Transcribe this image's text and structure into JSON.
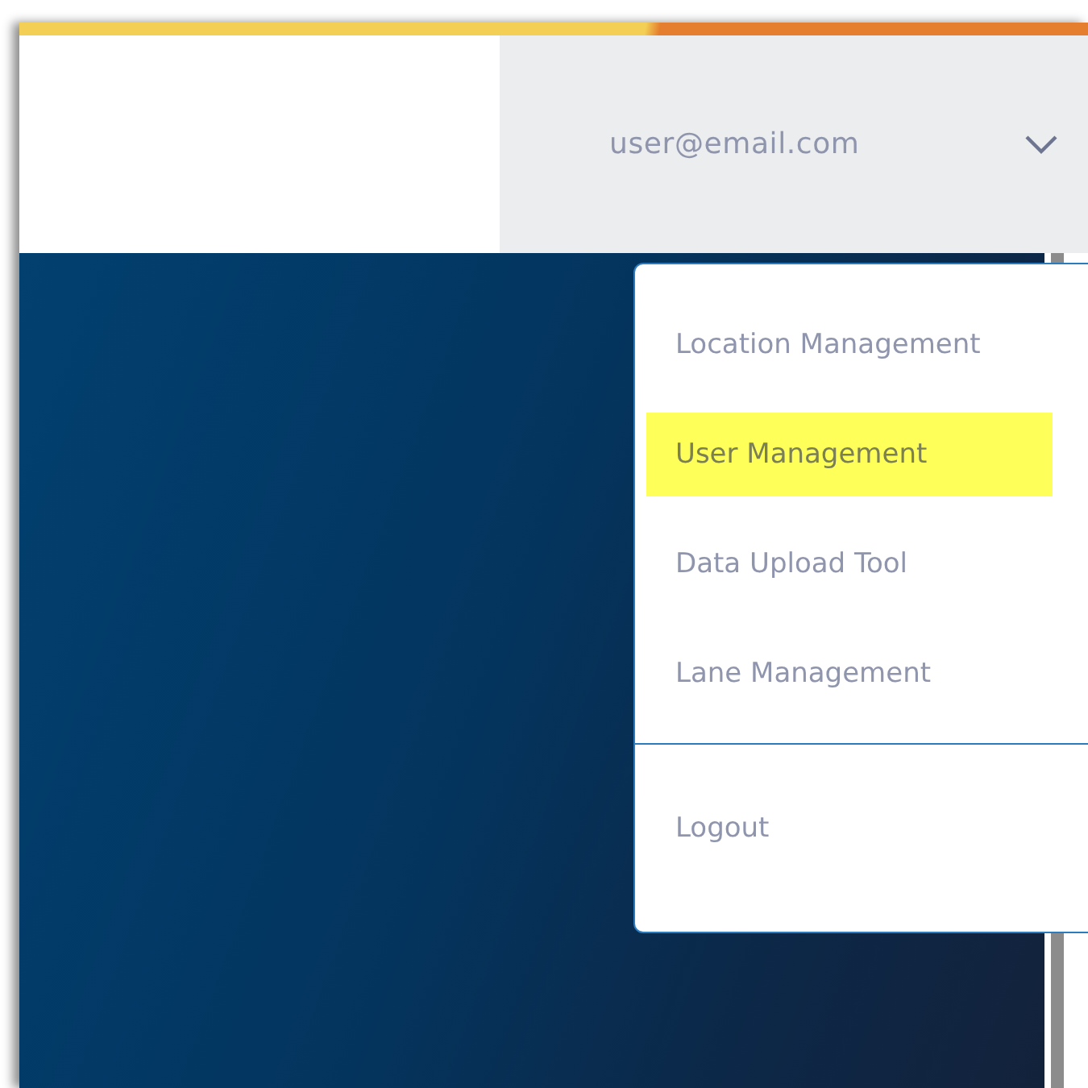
{
  "header": {
    "user_email": "user@email.com"
  },
  "menu": {
    "items": [
      {
        "label": "Location Management",
        "highlighted": false
      },
      {
        "label": "User Management",
        "highlighted": true
      },
      {
        "label": "Data Upload Tool",
        "highlighted": false
      },
      {
        "label": "Lane Management",
        "highlighted": false
      }
    ],
    "footer_items": [
      {
        "label": "Logout"
      }
    ]
  }
}
